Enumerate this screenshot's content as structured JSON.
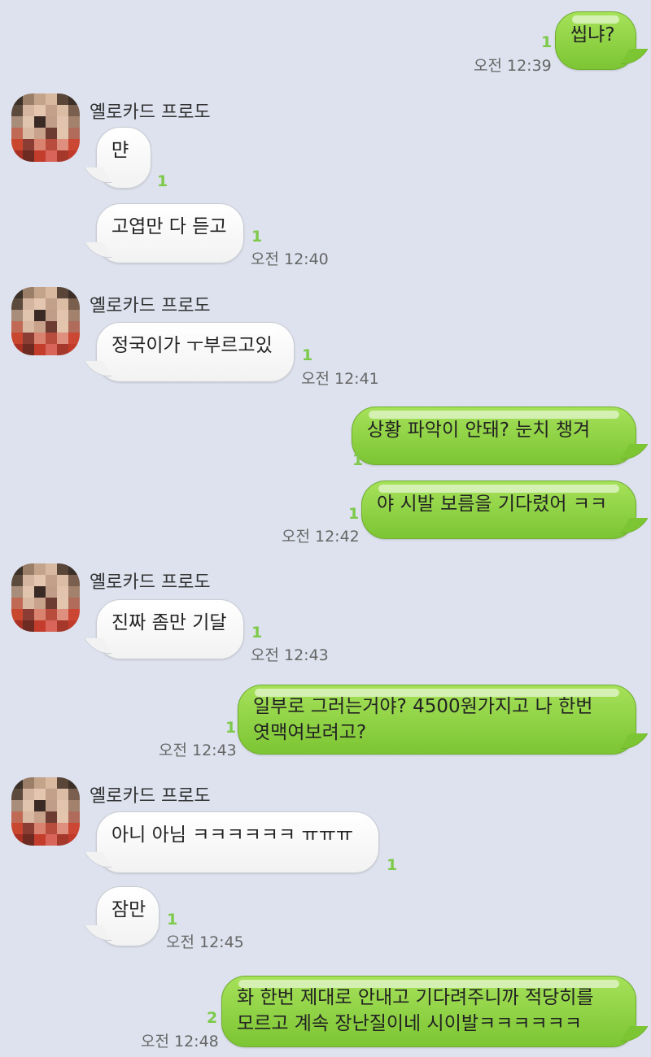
{
  "sender_name": "옐로카드 프로도",
  "colors": {
    "background": "#dde2ee",
    "outgoing_bubble": "#8fd447",
    "incoming_bubble": "#ffffff",
    "unread_count": "#7dc94a"
  },
  "messages": [
    {
      "dir": "out",
      "text": "씹냐?",
      "unread": "1",
      "time": "오전 12:39"
    },
    {
      "dir": "in",
      "text": "먄",
      "unread": "1",
      "time": ""
    },
    {
      "dir": "in",
      "text": "고엽만 다 듣고",
      "unread": "1",
      "time": "오전 12:40"
    },
    {
      "dir": "in",
      "text": "정국이가 ㅜ부르고있",
      "unread": "1",
      "time": "오전 12:41"
    },
    {
      "dir": "out",
      "text": "상황 파악이 안돼? 눈치 챙겨",
      "unread": "1",
      "time": ""
    },
    {
      "dir": "out",
      "text": "야 시발 보름을 기다렸어 ㅋㅋ",
      "unread": "1",
      "time": "오전 12:42"
    },
    {
      "dir": "in",
      "text": "진짜 좀만 기달",
      "unread": "1",
      "time": "오전 12:43"
    },
    {
      "dir": "out",
      "text_line1": "일부로 그러는거야? 4500원가지고 나 한번",
      "text_line2": "엿맥여보려고?",
      "unread": "1",
      "time": "오전 12:43"
    },
    {
      "dir": "in",
      "text": "아니 아님 ㅋㅋㅋㅋㅋㅋ ㅠㅠㅠ",
      "unread": "1",
      "time": ""
    },
    {
      "dir": "in",
      "text": "잠만",
      "unread": "1",
      "time": "오전 12:45"
    },
    {
      "dir": "out",
      "text_line1": "화 한번 제대로 안내고 기다려주니까 적당히를",
      "text_line2": "모르고 계속 장난질이네 시이발ㅋㅋㅋㅋㅋㅋ",
      "unread": "2",
      "time": "오전 12:48"
    }
  ]
}
